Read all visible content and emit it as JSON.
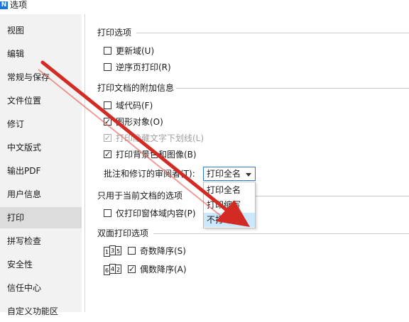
{
  "window": {
    "title": "选项",
    "icon_letter": "N"
  },
  "sidebar": {
    "items": [
      {
        "label": "视图"
      },
      {
        "label": "编辑"
      },
      {
        "label": "常规与保存"
      },
      {
        "label": "文件位置"
      },
      {
        "label": "修订"
      },
      {
        "label": "中文版式"
      },
      {
        "label": "输出PDF"
      },
      {
        "label": "用户信息"
      },
      {
        "label": "打印"
      },
      {
        "label": "拼写检查"
      },
      {
        "label": "安全性"
      },
      {
        "label": "信任中心"
      },
      {
        "label": "自定义功能区"
      }
    ],
    "active": "打印"
  },
  "print_options": {
    "title": "打印选项",
    "update_fields": {
      "label": "更新域(U)",
      "checked": false
    },
    "reverse_order": {
      "label": "逆序页打印(R)",
      "checked": false
    }
  },
  "doc_info": {
    "title": "打印文档的附加信息",
    "field_codes": {
      "label": "域代码(F)",
      "checked": false
    },
    "drawing_objects": {
      "label": "图形对象(O)",
      "checked": true
    },
    "hidden_text_underline": {
      "label": "打印隐藏文字下划线(L)",
      "checked": true,
      "disabled": true
    },
    "background": {
      "label": "打印背景色和图像(B)",
      "checked": true
    },
    "reviewer_label": "批注和修订的审阅者(T):",
    "reviewer_select": {
      "value": "打印全名",
      "options": [
        "打印全名",
        "打印缩写",
        "不打印"
      ],
      "highlighted": "不打印"
    }
  },
  "current_doc": {
    "title": "只用于当前文档的选项",
    "form_data_only": {
      "label": "仅打印窗体域内容(P)",
      "checked": false
    }
  },
  "duplex": {
    "title": "双面打印选项",
    "odd_desc": {
      "label": "奇数降序(S)",
      "checked": false,
      "icon_digits": "135"
    },
    "even_desc": {
      "label": "偶数降序(A)",
      "checked": true,
      "icon_digits": "642"
    }
  },
  "annotation": {
    "color": "#d42a24"
  }
}
